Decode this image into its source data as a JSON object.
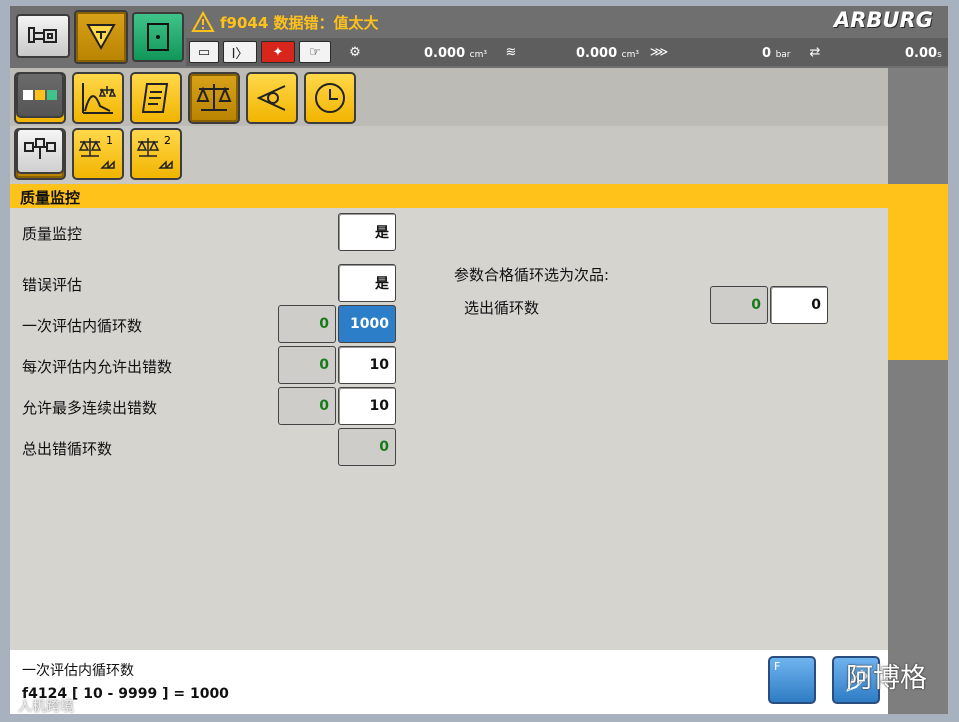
{
  "alarm": {
    "icon": "warning-triangle-icon",
    "text": "f9044 数据错：值太大"
  },
  "brand": {
    "logo": "ARBURG"
  },
  "status": {
    "volume1": {
      "value": "0.000",
      "unit": "cm³"
    },
    "volume2": {
      "value": "0.000",
      "unit": "cm³"
    },
    "pressure": {
      "value": "0",
      "unit": "bar"
    },
    "time": {
      "value": "0.00",
      "unit": "s"
    }
  },
  "section": {
    "title": "质量监控"
  },
  "form": {
    "quality_monitor": {
      "label": "质量监控",
      "value": "是"
    },
    "error_eval": {
      "label": "错误评估",
      "value": "是"
    },
    "cycles_per_eval": {
      "label": "一次评估内循环数",
      "actual": "0",
      "value": "1000"
    },
    "errors_allowed": {
      "label": "每次评估内允许出错数",
      "actual": "0",
      "value": "10"
    },
    "max_consecutive": {
      "label": "允许最多连续出错数",
      "actual": "0",
      "value": "10"
    },
    "total_error_cycles": {
      "label": "总出错循环数",
      "actual": "0"
    },
    "reject_heading": "参数合格循环选为次品:",
    "reject_cycles": {
      "label": "选出循环数",
      "actual": "0",
      "value": "0"
    }
  },
  "help": {
    "line1": "一次评估内循环数",
    "line2": "f4124 [ 10 - 9999 ] = 1000"
  },
  "tabs": {
    "sub1": "1",
    "sub2": "2"
  },
  "watermark": {
    "right": "阿博格",
    "left": "人机跨境"
  },
  "colors": {
    "accent": "#ffc21a",
    "active_field": "#2c7ec8",
    "actual_value": "#1a7a1a"
  }
}
